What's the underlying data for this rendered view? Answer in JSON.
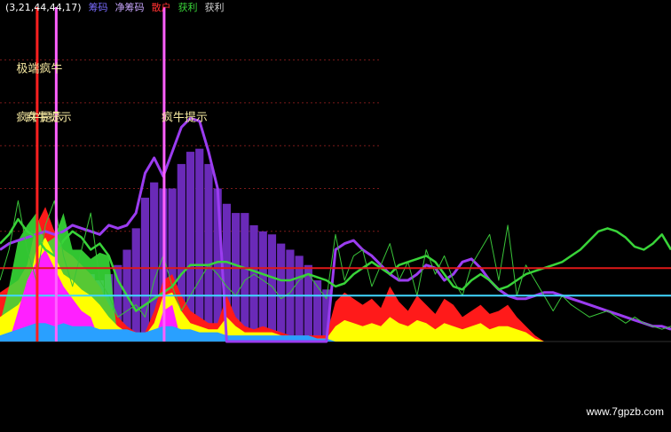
{
  "header": [
    {
      "text": "(3,21,44,44,17)",
      "color": "#ffffff"
    },
    {
      "text": "筹码",
      "color": "#7a6cff"
    },
    {
      "text": "净筹码",
      "color": "#c9a7ff"
    },
    {
      "text": "散户",
      "color": "#ff3030"
    },
    {
      "text": "获利",
      "color": "#39d439"
    },
    {
      "text": "获利",
      "color": "#cfcfcf"
    }
  ],
  "annotations": [
    {
      "text": "极端疯牛",
      "x": 2,
      "y": 0.88
    },
    {
      "text": "疯牛提示",
      "x": 2,
      "y": 0.72
    },
    {
      "text": "疯牛提示",
      "x": 3,
      "y": 0.72
    },
    {
      "text": "疯牛提示",
      "x": 18,
      "y": 0.72
    }
  ],
  "watermark": "www.7gpzb.com",
  "colors": {
    "background": "#000000",
    "red": "#ff1a1a",
    "yellow": "#ffff00",
    "magenta": "#ff20ff",
    "green": "#33e633",
    "purple": "#6a2ab8",
    "purple_line": "#9b3cf0",
    "cyan": "#40e0ff",
    "grid": "#7a1a1a",
    "h_red": "#e01818",
    "h_cyan": "#40d8ff",
    "v_red": "#ff2020",
    "v_pink": "#ff60ff"
  },
  "chart_data": {
    "type": "area",
    "x_count": 75,
    "ylim": [
      0,
      1
    ],
    "grid": true,
    "h_lines": [
      {
        "y": 0.24,
        "color": "#e01818"
      },
      {
        "y": 0.15,
        "color": "#40d8ff"
      }
    ],
    "v_lines": [
      {
        "x": 4.1,
        "color": "#ff2020"
      },
      {
        "x": 6.2,
        "color": "#ff60ff"
      },
      {
        "x": 18.1,
        "color": "#ff60ff"
      }
    ],
    "purple_bars": [
      0,
      0,
      0.1,
      0.2,
      0.22,
      0.2,
      0.15,
      0.18,
      0.2,
      0.22,
      0.22,
      0.2,
      0.22,
      0.25,
      0.3,
      0.37,
      0.47,
      0.52,
      0.5,
      0.5,
      0.58,
      0.62,
      0.63,
      0.58,
      0.5,
      0.45,
      0.42,
      0.42,
      0.38,
      0.36,
      0.35,
      0.32,
      0.3,
      0.28,
      0.25,
      0.2,
      0.17,
      0,
      0,
      0,
      0,
      0,
      0,
      0,
      0,
      0,
      0,
      0,
      0,
      0,
      0,
      0,
      0,
      0,
      0,
      0,
      0,
      0,
      0,
      0,
      0,
      0,
      0,
      0,
      0,
      0,
      0,
      0,
      0,
      0,
      0,
      0,
      0,
      0,
      0
    ],
    "series": [
      {
        "name": "",
        "color": "#ff1a1a",
        "values": [
          0.16,
          0.18,
          0.2,
          0.25,
          0.38,
          0.44,
          0.36,
          0.3,
          0.28,
          0.25,
          0.22,
          0.18,
          0.12,
          0.08,
          0.05,
          0.03,
          0.03,
          0.1,
          0.2,
          0.22,
          0.15,
          0.1,
          0.08,
          0.06,
          0.06,
          0.15,
          0.08,
          0.05,
          0.04,
          0.05,
          0.04,
          0.03,
          0.02,
          0.02,
          0.02,
          0.02,
          0.02,
          0.13,
          0.16,
          0.14,
          0.12,
          0.14,
          0.11,
          0.18,
          0.13,
          0.1,
          0.15,
          0.12,
          0.09,
          0.14,
          0.12,
          0.08,
          0.1,
          0.12,
          0.09,
          0.1,
          0.12,
          0.08,
          0.05,
          0.02,
          0,
          0,
          0,
          0,
          0,
          0,
          0,
          0,
          0,
          0,
          0,
          0,
          0,
          0,
          0
        ]
      },
      {
        "name": "",
        "color": "#39e839",
        "values": [
          0.06,
          0.18,
          0.33,
          0.38,
          0.42,
          0.32,
          0.34,
          0.42,
          0.3,
          0.3,
          0.27,
          0.29,
          0.28,
          0,
          0,
          0,
          0,
          0,
          0,
          0,
          0,
          0,
          0,
          0,
          0,
          0,
          0,
          0,
          0,
          0,
          0,
          0,
          0,
          0,
          0,
          0,
          0,
          0,
          0,
          0,
          0,
          0,
          0,
          0,
          0,
          0,
          0,
          0,
          0,
          0,
          0,
          0,
          0,
          0,
          0,
          0,
          0,
          0,
          0,
          0,
          0,
          0,
          0,
          0,
          0,
          0,
          0,
          0,
          0,
          0,
          0,
          0,
          0,
          0,
          0
        ]
      },
      {
        "name": "",
        "color": "#ffff00",
        "values": [
          0.08,
          0.1,
          0.12,
          0.16,
          0.3,
          0.34,
          0.28,
          0.22,
          0.2,
          0.17,
          0.15,
          0.12,
          0.08,
          0.05,
          0.03,
          0.02,
          0.02,
          0.06,
          0.15,
          0.16,
          0.1,
          0.06,
          0.05,
          0.04,
          0.04,
          0.08,
          0.05,
          0.03,
          0.03,
          0.03,
          0.03,
          0.02,
          0.01,
          0.01,
          0.01,
          0.01,
          0.01,
          0.05,
          0.07,
          0.06,
          0.05,
          0.06,
          0.05,
          0.08,
          0.06,
          0.05,
          0.07,
          0.06,
          0.04,
          0.06,
          0.05,
          0.04,
          0.05,
          0.06,
          0.04,
          0.05,
          0.05,
          0.04,
          0.03,
          0.01,
          0,
          0,
          0,
          0,
          0,
          0,
          0,
          0,
          0,
          0,
          0,
          0,
          0,
          0,
          0
        ]
      },
      {
        "name": "",
        "color": "#ff20ff",
        "values": [
          0,
          0,
          0.1,
          0.2,
          0.26,
          0.3,
          0.24,
          0.18,
          0.14,
          0.1,
          0.08,
          0,
          0,
          0,
          0,
          0,
          0,
          0,
          0.1,
          0.12,
          0,
          0,
          0,
          0,
          0,
          0,
          0,
          0,
          0,
          0,
          0,
          0,
          0,
          0,
          0,
          0,
          0,
          0,
          0,
          0,
          0,
          0,
          0,
          0,
          0,
          0,
          0,
          0,
          0,
          0,
          0,
          0,
          0,
          0,
          0,
          0,
          0,
          0,
          0,
          0,
          0,
          0,
          0,
          0,
          0,
          0,
          0,
          0,
          0,
          0,
          0,
          0,
          0,
          0,
          0
        ]
      },
      {
        "name": "",
        "color": "#29a0ff",
        "values": [
          0.02,
          0.03,
          0.04,
          0.05,
          0.06,
          0.06,
          0.05,
          0.06,
          0.05,
          0.05,
          0.05,
          0.04,
          0.04,
          0.04,
          0.04,
          0.03,
          0.03,
          0.04,
          0.05,
          0.05,
          0.04,
          0.04,
          0.03,
          0.03,
          0.03,
          0.02,
          0.02,
          0.02,
          0.02,
          0.02,
          0.02,
          0.02,
          0.02,
          0.02,
          0.02,
          0.01,
          0.01,
          0,
          0,
          0,
          0,
          0,
          0,
          0,
          0,
          0,
          0,
          0,
          0,
          0,
          0,
          0,
          0,
          0,
          0,
          0,
          0,
          0,
          0,
          0,
          0,
          0,
          0,
          0,
          0,
          0,
          0,
          0,
          0,
          0,
          0,
          0,
          0,
          0,
          0
        ]
      },
      {
        "name": "",
        "color": "#9b3cf0",
        "values": [
          0.3,
          0.32,
          0.33,
          0.34,
          0.35,
          0.36,
          0.35,
          0.36,
          0.38,
          0.37,
          0.36,
          0.35,
          0.38,
          0.37,
          0.38,
          0.42,
          0.55,
          0.6,
          0.54,
          0.62,
          0.7,
          0.73,
          0.72,
          0.62,
          0.5,
          0,
          0,
          0,
          0,
          0,
          0,
          0,
          0,
          0,
          0,
          0,
          0,
          0.3,
          0.32,
          0.33,
          0.3,
          0.28,
          0.25,
          0.22,
          0.2,
          0.2,
          0.22,
          0.25,
          0.24,
          0.2,
          0.22,
          0.26,
          0.27,
          0.24,
          0.2,
          0.17,
          0.15,
          0.14,
          0.14,
          0.15,
          0.16,
          0.16,
          0.15,
          0.14,
          0.13,
          0.12,
          0.11,
          0.1,
          0.09,
          0.08,
          0.07,
          0.06,
          0.05,
          0.05,
          0.04
        ]
      },
      {
        "name": "",
        "color": "#39d439",
        "values": [
          0.32,
          0.35,
          0.4,
          0.36,
          0.34,
          0.3,
          0.28,
          0.33,
          0.36,
          0.34,
          0.3,
          0.32,
          0.28,
          0.2,
          0.15,
          0.1,
          0.12,
          0.14,
          0.16,
          0.18,
          0.22,
          0.25,
          0.25,
          0.25,
          0.26,
          0.26,
          0.25,
          0.24,
          0.23,
          0.22,
          0.21,
          0.2,
          0.2,
          0.21,
          0.22,
          0.21,
          0.2,
          0.18,
          0.19,
          0.22,
          0.24,
          0.26,
          0.24,
          0.22,
          0.25,
          0.26,
          0.27,
          0.28,
          0.26,
          0.22,
          0.18,
          0.17,
          0.2,
          0.22,
          0.2,
          0.17,
          0.18,
          0.2,
          0.22,
          0.23,
          0.24,
          0.25,
          0.26,
          0.28,
          0.3,
          0.33,
          0.36,
          0.37,
          0.36,
          0.34,
          0.31,
          0.3,
          0.32,
          0.35,
          0.3
        ]
      },
      {
        "name": "",
        "color": "#39c439",
        "values": [
          0.2,
          0.3,
          0.46,
          0.3,
          0.2,
          0.38,
          0.46,
          0.28,
          0.18,
          0.3,
          0.42,
          0.2,
          0.15,
          0.08,
          0.1,
          0.12,
          0.08,
          0.2,
          0.28,
          0.18,
          0.1,
          0.15,
          0.2,
          0.25,
          0.22,
          0.18,
          0.15,
          0.2,
          0.22,
          0.2,
          0.18,
          0.14,
          0.16,
          0.2,
          0.22,
          0.18,
          0.14,
          0.35,
          0.2,
          0.28,
          0.3,
          0.18,
          0.25,
          0.32,
          0.2,
          0.26,
          0.15,
          0.3,
          0.22,
          0.28,
          0.2,
          0.15,
          0.25,
          0.3,
          0.35,
          0.2,
          0.38,
          0.15,
          0.25,
          0.2,
          0.15,
          0.1,
          0.15,
          0.12,
          0.1,
          0.08,
          0.09,
          0.1,
          0.08,
          0.06,
          0.08,
          0.06,
          0.05,
          0.04,
          0.05
        ]
      }
    ]
  }
}
